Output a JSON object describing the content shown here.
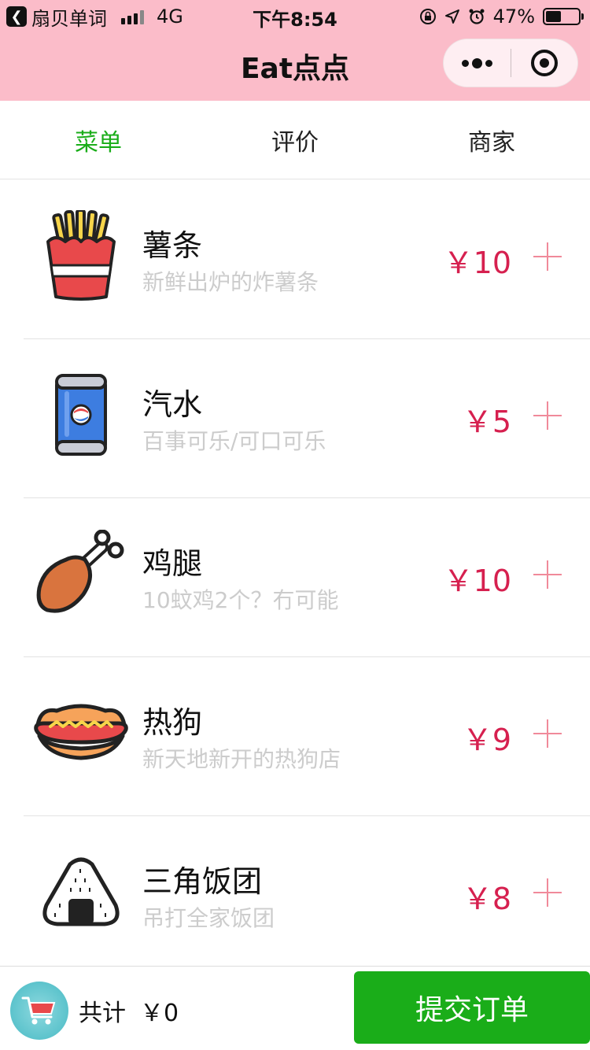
{
  "status_bar": {
    "back_app": "扇贝单词",
    "network": "4G",
    "time": "下午8:54",
    "battery": "47%",
    "battery_level": 0.47
  },
  "nav": {
    "title": "Eat点点"
  },
  "tabs": [
    {
      "label": "菜单",
      "active": true
    },
    {
      "label": "评价",
      "active": false
    },
    {
      "label": "商家",
      "active": false
    }
  ],
  "menu": [
    {
      "name": "薯条",
      "desc": "新鲜出炉的炸薯条",
      "price": "￥10",
      "icon": "fries-icon"
    },
    {
      "name": "汽水",
      "desc": "百事可乐/可口可乐",
      "price": "￥5",
      "icon": "soda-can-icon"
    },
    {
      "name": "鸡腿",
      "desc": "10蚊鸡2个？冇可能",
      "price": "￥10",
      "icon": "chicken-leg-icon"
    },
    {
      "name": "热狗",
      "desc": "新天地新开的热狗店",
      "price": "￥9",
      "icon": "hotdog-icon"
    },
    {
      "name": "三角饭团",
      "desc": "吊打全家饭团",
      "price": "￥8",
      "icon": "onigiri-icon"
    }
  ],
  "cart": {
    "total_label": "共计",
    "total_value": "￥0",
    "submit_label": "提交订单"
  },
  "colors": {
    "header_bg": "#fbbcc9",
    "accent_green": "#1aad19",
    "price_red": "#d6204f"
  }
}
